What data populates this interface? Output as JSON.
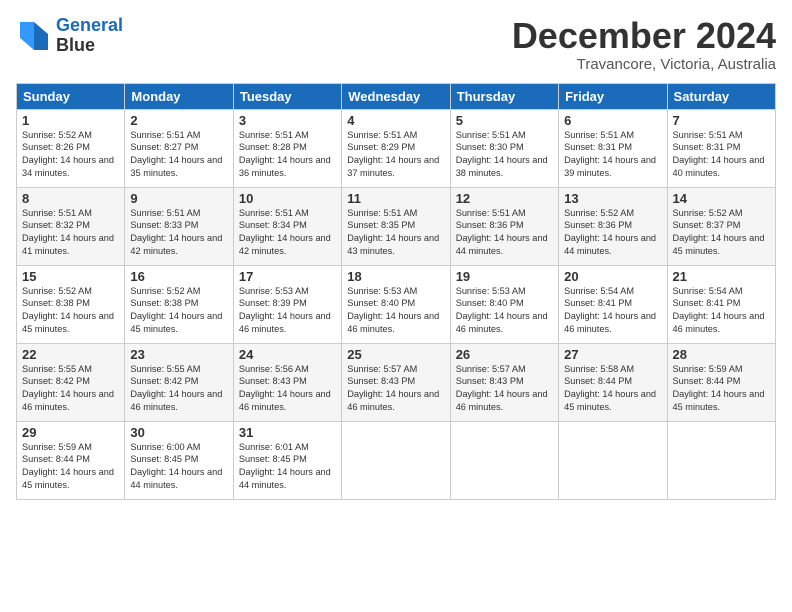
{
  "header": {
    "logo_line1": "General",
    "logo_line2": "Blue",
    "month_title": "December 2024",
    "location": "Travancore, Victoria, Australia"
  },
  "days_of_week": [
    "Sunday",
    "Monday",
    "Tuesday",
    "Wednesday",
    "Thursday",
    "Friday",
    "Saturday"
  ],
  "weeks": [
    [
      {
        "num": "1",
        "sunrise": "5:52 AM",
        "sunset": "8:26 PM",
        "daylight": "14 hours and 34 minutes."
      },
      {
        "num": "2",
        "sunrise": "5:51 AM",
        "sunset": "8:27 PM",
        "daylight": "14 hours and 35 minutes."
      },
      {
        "num": "3",
        "sunrise": "5:51 AM",
        "sunset": "8:28 PM",
        "daylight": "14 hours and 36 minutes."
      },
      {
        "num": "4",
        "sunrise": "5:51 AM",
        "sunset": "8:29 PM",
        "daylight": "14 hours and 37 minutes."
      },
      {
        "num": "5",
        "sunrise": "5:51 AM",
        "sunset": "8:30 PM",
        "daylight": "14 hours and 38 minutes."
      },
      {
        "num": "6",
        "sunrise": "5:51 AM",
        "sunset": "8:31 PM",
        "daylight": "14 hours and 39 minutes."
      },
      {
        "num": "7",
        "sunrise": "5:51 AM",
        "sunset": "8:31 PM",
        "daylight": "14 hours and 40 minutes."
      }
    ],
    [
      {
        "num": "8",
        "sunrise": "5:51 AM",
        "sunset": "8:32 PM",
        "daylight": "14 hours and 41 minutes."
      },
      {
        "num": "9",
        "sunrise": "5:51 AM",
        "sunset": "8:33 PM",
        "daylight": "14 hours and 42 minutes."
      },
      {
        "num": "10",
        "sunrise": "5:51 AM",
        "sunset": "8:34 PM",
        "daylight": "14 hours and 42 minutes."
      },
      {
        "num": "11",
        "sunrise": "5:51 AM",
        "sunset": "8:35 PM",
        "daylight": "14 hours and 43 minutes."
      },
      {
        "num": "12",
        "sunrise": "5:51 AM",
        "sunset": "8:36 PM",
        "daylight": "14 hours and 44 minutes."
      },
      {
        "num": "13",
        "sunrise": "5:52 AM",
        "sunset": "8:36 PM",
        "daylight": "14 hours and 44 minutes."
      },
      {
        "num": "14",
        "sunrise": "5:52 AM",
        "sunset": "8:37 PM",
        "daylight": "14 hours and 45 minutes."
      }
    ],
    [
      {
        "num": "15",
        "sunrise": "5:52 AM",
        "sunset": "8:38 PM",
        "daylight": "14 hours and 45 minutes."
      },
      {
        "num": "16",
        "sunrise": "5:52 AM",
        "sunset": "8:38 PM",
        "daylight": "14 hours and 45 minutes."
      },
      {
        "num": "17",
        "sunrise": "5:53 AM",
        "sunset": "8:39 PM",
        "daylight": "14 hours and 46 minutes."
      },
      {
        "num": "18",
        "sunrise": "5:53 AM",
        "sunset": "8:40 PM",
        "daylight": "14 hours and 46 minutes."
      },
      {
        "num": "19",
        "sunrise": "5:53 AM",
        "sunset": "8:40 PM",
        "daylight": "14 hours and 46 minutes."
      },
      {
        "num": "20",
        "sunrise": "5:54 AM",
        "sunset": "8:41 PM",
        "daylight": "14 hours and 46 minutes."
      },
      {
        "num": "21",
        "sunrise": "5:54 AM",
        "sunset": "8:41 PM",
        "daylight": "14 hours and 46 minutes."
      }
    ],
    [
      {
        "num": "22",
        "sunrise": "5:55 AM",
        "sunset": "8:42 PM",
        "daylight": "14 hours and 46 minutes."
      },
      {
        "num": "23",
        "sunrise": "5:55 AM",
        "sunset": "8:42 PM",
        "daylight": "14 hours and 46 minutes."
      },
      {
        "num": "24",
        "sunrise": "5:56 AM",
        "sunset": "8:43 PM",
        "daylight": "14 hours and 46 minutes."
      },
      {
        "num": "25",
        "sunrise": "5:57 AM",
        "sunset": "8:43 PM",
        "daylight": "14 hours and 46 minutes."
      },
      {
        "num": "26",
        "sunrise": "5:57 AM",
        "sunset": "8:43 PM",
        "daylight": "14 hours and 46 minutes."
      },
      {
        "num": "27",
        "sunrise": "5:58 AM",
        "sunset": "8:44 PM",
        "daylight": "14 hours and 45 minutes."
      },
      {
        "num": "28",
        "sunrise": "5:59 AM",
        "sunset": "8:44 PM",
        "daylight": "14 hours and 45 minutes."
      }
    ],
    [
      {
        "num": "29",
        "sunrise": "5:59 AM",
        "sunset": "8:44 PM",
        "daylight": "14 hours and 45 minutes."
      },
      {
        "num": "30",
        "sunrise": "6:00 AM",
        "sunset": "8:45 PM",
        "daylight": "14 hours and 44 minutes."
      },
      {
        "num": "31",
        "sunrise": "6:01 AM",
        "sunset": "8:45 PM",
        "daylight": "14 hours and 44 minutes."
      },
      null,
      null,
      null,
      null
    ]
  ]
}
